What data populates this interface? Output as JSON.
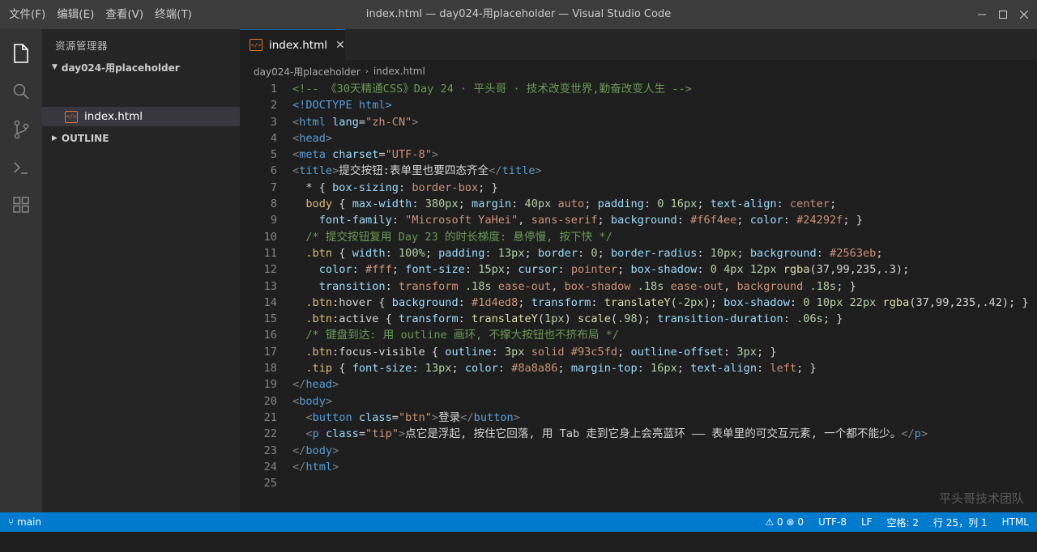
{
  "menu": [
    "文件(F)",
    "编辑(E)",
    "查看(V)",
    "终端(T)"
  ],
  "window": {
    "title": "index.html — day024-用placeholder — Visual Studio Code"
  },
  "activity_bar": [
    "files-icon",
    "search-icon",
    "source-control-icon",
    "terminal-icon",
    "extensions-icon"
  ],
  "sidebar": {
    "title": "资源管理器",
    "folder": "day024-用placeholder",
    "file": "index.html",
    "outline": "OUTLINE"
  },
  "tab": {
    "label": "index.html",
    "icon_text": "</>"
  },
  "breadcrumbs": [
    "day024-用placeholder",
    "index.html"
  ],
  "code_lines": [
    [
      [
        "c",
        "<!-- 《30天精通CSS》Day 24 · 平头哥 · 技术改变世界,勤奋改变人生 -->"
      ]
    ],
    [
      [
        "d",
        "<!DOCTYPE html>"
      ]
    ],
    [
      [
        "p",
        "<"
      ],
      [
        "d",
        "html"
      ],
      [
        "t",
        " "
      ],
      [
        "a",
        "lang"
      ],
      [
        "t",
        "="
      ],
      [
        "s",
        "\"zh-CN\""
      ],
      [
        "p",
        ">"
      ]
    ],
    [
      [
        "p",
        "<"
      ],
      [
        "d",
        "head"
      ],
      [
        "p",
        ">"
      ]
    ],
    [
      [
        "p",
        "<"
      ],
      [
        "d",
        "meta"
      ],
      [
        "t",
        " "
      ],
      [
        "a",
        "charset"
      ],
      [
        "t",
        "="
      ],
      [
        "s",
        "\"UTF-8\""
      ],
      [
        "p",
        ">"
      ]
    ],
    [
      [
        "p",
        "<"
      ],
      [
        "d",
        "title"
      ],
      [
        "p",
        ">"
      ],
      [
        "t",
        "提交按钮:表单里也要四态齐全"
      ],
      [
        "p",
        "</"
      ],
      [
        "d",
        "title"
      ],
      [
        "p",
        ">"
      ]
    ],
    [
      [
        "t",
        "  * { "
      ],
      [
        "a",
        "box-sizing"
      ],
      [
        "t",
        ": "
      ],
      [
        "v",
        "border-box"
      ],
      [
        "t",
        "; }"
      ]
    ],
    [
      [
        "t",
        "  "
      ],
      [
        "y",
        "body"
      ],
      [
        "t",
        " { "
      ],
      [
        "a",
        "max-width"
      ],
      [
        "t",
        ": "
      ],
      [
        "n",
        "380px"
      ],
      [
        "t",
        "; "
      ],
      [
        "a",
        "margin"
      ],
      [
        "t",
        ": "
      ],
      [
        "n",
        "40px"
      ],
      [
        "t",
        " "
      ],
      [
        "v",
        "auto"
      ],
      [
        "t",
        "; "
      ],
      [
        "a",
        "padding"
      ],
      [
        "t",
        ": "
      ],
      [
        "n",
        "0"
      ],
      [
        "t",
        " "
      ],
      [
        "n",
        "16px"
      ],
      [
        "t",
        "; "
      ],
      [
        "a",
        "text-align"
      ],
      [
        "t",
        ": "
      ],
      [
        "v",
        "center"
      ],
      [
        "t",
        ";"
      ]
    ],
    [
      [
        "t",
        "    "
      ],
      [
        "a",
        "font-family"
      ],
      [
        "t",
        ": "
      ],
      [
        "s",
        "\"Microsoft YaHei\""
      ],
      [
        "t",
        ", "
      ],
      [
        "v",
        "sans-serif"
      ],
      [
        "t",
        "; "
      ],
      [
        "a",
        "background"
      ],
      [
        "t",
        ": "
      ],
      [
        "v",
        "#f6f4ee"
      ],
      [
        "t",
        "; "
      ],
      [
        "a",
        "color"
      ],
      [
        "t",
        ": "
      ],
      [
        "v",
        "#24292f"
      ],
      [
        "t",
        "; }"
      ]
    ],
    [
      [
        "t",
        "  "
      ],
      [
        "c",
        "/* 提交按钮复用 Day 23 的时长梯度: 悬停慢, 按下快 */"
      ]
    ],
    [
      [
        "t",
        "  "
      ],
      [
        "y",
        ".btn"
      ],
      [
        "t",
        " { "
      ],
      [
        "a",
        "width"
      ],
      [
        "t",
        ": "
      ],
      [
        "n",
        "100%"
      ],
      [
        "t",
        "; "
      ],
      [
        "a",
        "padding"
      ],
      [
        "t",
        ": "
      ],
      [
        "n",
        "13px"
      ],
      [
        "t",
        "; "
      ],
      [
        "a",
        "border"
      ],
      [
        "t",
        ": "
      ],
      [
        "n",
        "0"
      ],
      [
        "t",
        "; "
      ],
      [
        "a",
        "border-radius"
      ],
      [
        "t",
        ": "
      ],
      [
        "n",
        "10px"
      ],
      [
        "t",
        "; "
      ],
      [
        "a",
        "background"
      ],
      [
        "t",
        ": "
      ],
      [
        "v",
        "#2563eb"
      ],
      [
        "t",
        ";"
      ]
    ],
    [
      [
        "t",
        "    "
      ],
      [
        "a",
        "color"
      ],
      [
        "t",
        ": "
      ],
      [
        "v",
        "#fff"
      ],
      [
        "t",
        "; "
      ],
      [
        "a",
        "font-size"
      ],
      [
        "t",
        ": "
      ],
      [
        "n",
        "15px"
      ],
      [
        "t",
        "; "
      ],
      [
        "a",
        "cursor"
      ],
      [
        "t",
        ": "
      ],
      [
        "v",
        "pointer"
      ],
      [
        "t",
        "; "
      ],
      [
        "a",
        "box-shadow"
      ],
      [
        "t",
        ": "
      ],
      [
        "n",
        "0"
      ],
      [
        "t",
        " "
      ],
      [
        "n",
        "4px"
      ],
      [
        "t",
        " "
      ],
      [
        "n",
        "12px"
      ],
      [
        "t",
        " "
      ],
      [
        "f",
        "rgba"
      ],
      [
        "t",
        "(37,99,235,.3);"
      ]
    ],
    [
      [
        "t",
        "    "
      ],
      [
        "a",
        "transition"
      ],
      [
        "t",
        ": "
      ],
      [
        "v",
        "transform"
      ],
      [
        "t",
        " "
      ],
      [
        "n",
        ".18s"
      ],
      [
        "t",
        " "
      ],
      [
        "v",
        "ease-out"
      ],
      [
        "t",
        ", "
      ],
      [
        "v",
        "box-shadow"
      ],
      [
        "t",
        " "
      ],
      [
        "n",
        ".18s"
      ],
      [
        "t",
        " "
      ],
      [
        "v",
        "ease-out"
      ],
      [
        "t",
        ", "
      ],
      [
        "v",
        "background"
      ],
      [
        "t",
        " "
      ],
      [
        "n",
        ".18s"
      ],
      [
        "t",
        "; }"
      ]
    ],
    [
      [
        "t",
        "  "
      ],
      [
        "y",
        ".btn"
      ],
      [
        "t",
        ":hover { "
      ],
      [
        "a",
        "background"
      ],
      [
        "t",
        ": "
      ],
      [
        "v",
        "#1d4ed8"
      ],
      [
        "t",
        "; "
      ],
      [
        "a",
        "transform"
      ],
      [
        "t",
        ": "
      ],
      [
        "f",
        "translateY"
      ],
      [
        "t",
        "("
      ],
      [
        "n",
        "-2px"
      ],
      [
        "t",
        "); "
      ],
      [
        "a",
        "box-shadow"
      ],
      [
        "t",
        ": "
      ],
      [
        "n",
        "0"
      ],
      [
        "t",
        " "
      ],
      [
        "n",
        "10px"
      ],
      [
        "t",
        " "
      ],
      [
        "n",
        "22px"
      ],
      [
        "t",
        " "
      ],
      [
        "f",
        "rgba"
      ],
      [
        "t",
        "(37,99,235,.42); }"
      ]
    ],
    [
      [
        "t",
        "  "
      ],
      [
        "y",
        ".btn"
      ],
      [
        "t",
        ":active { "
      ],
      [
        "a",
        "transform"
      ],
      [
        "t",
        ": "
      ],
      [
        "f",
        "translateY"
      ],
      [
        "t",
        "("
      ],
      [
        "n",
        "1px"
      ],
      [
        "t",
        ") "
      ],
      [
        "f",
        "scale"
      ],
      [
        "t",
        "("
      ],
      [
        "n",
        ".98"
      ],
      [
        "t",
        "); "
      ],
      [
        "a",
        "transition-duration"
      ],
      [
        "t",
        ": "
      ],
      [
        "n",
        ".06s"
      ],
      [
        "t",
        "; }"
      ]
    ],
    [
      [
        "t",
        "  "
      ],
      [
        "c",
        "/* 键盘到达: 用 outline 画环, 不撑大按钮也不挤布局 */"
      ]
    ],
    [
      [
        "t",
        "  "
      ],
      [
        "y",
        ".btn"
      ],
      [
        "t",
        ":focus-visible { "
      ],
      [
        "a",
        "outline"
      ],
      [
        "t",
        ": "
      ],
      [
        "n",
        "3px"
      ],
      [
        "t",
        " "
      ],
      [
        "v",
        "solid"
      ],
      [
        "t",
        " "
      ],
      [
        "v",
        "#93c5fd"
      ],
      [
        "t",
        "; "
      ],
      [
        "a",
        "outline-offset"
      ],
      [
        "t",
        ": "
      ],
      [
        "n",
        "3px"
      ],
      [
        "t",
        "; }"
      ]
    ],
    [
      [
        "t",
        "  "
      ],
      [
        "y",
        ".tip"
      ],
      [
        "t",
        " { "
      ],
      [
        "a",
        "font-size"
      ],
      [
        "t",
        ": "
      ],
      [
        "n",
        "13px"
      ],
      [
        "t",
        "; "
      ],
      [
        "a",
        "color"
      ],
      [
        "t",
        ": "
      ],
      [
        "v",
        "#8a8a86"
      ],
      [
        "t",
        "; "
      ],
      [
        "a",
        "margin-top"
      ],
      [
        "t",
        ": "
      ],
      [
        "n",
        "16px"
      ],
      [
        "t",
        "; "
      ],
      [
        "a",
        "text-align"
      ],
      [
        "t",
        ": "
      ],
      [
        "v",
        "left"
      ],
      [
        "t",
        "; }"
      ]
    ],
    [
      [
        "p",
        "</"
      ],
      [
        "d",
        "head"
      ],
      [
        "p",
        ">"
      ]
    ],
    [
      [
        "p",
        "<"
      ],
      [
        "d",
        "body"
      ],
      [
        "p",
        ">"
      ]
    ],
    [
      [
        "t",
        "  "
      ],
      [
        "p",
        "<"
      ],
      [
        "d",
        "button"
      ],
      [
        "t",
        " "
      ],
      [
        "a",
        "class"
      ],
      [
        "t",
        "="
      ],
      [
        "s",
        "\"btn\""
      ],
      [
        "p",
        ">"
      ],
      [
        "t",
        "登录"
      ],
      [
        "p",
        "</"
      ],
      [
        "d",
        "button"
      ],
      [
        "p",
        ">"
      ]
    ],
    [
      [
        "t",
        "  "
      ],
      [
        "p",
        "<"
      ],
      [
        "d",
        "p"
      ],
      [
        "t",
        " "
      ],
      [
        "a",
        "class"
      ],
      [
        "t",
        "="
      ],
      [
        "s",
        "\"tip\""
      ],
      [
        "p",
        ">"
      ],
      [
        "t",
        "点它是浮起, 按住它回落, 用 Tab 走到它身上会亮蓝环 —— 表单里的可交互元素, 一个都不能少。"
      ],
      [
        "p",
        "</"
      ],
      [
        "d",
        "p"
      ],
      [
        "p",
        ">"
      ]
    ],
    [
      [
        "p",
        "</"
      ],
      [
        "d",
        "body"
      ],
      [
        "p",
        ">"
      ]
    ],
    [
      [
        "p",
        "</"
      ],
      [
        "d",
        "html"
      ],
      [
        "p",
        ">"
      ]
    ],
    [
      [
        "t",
        ""
      ]
    ]
  ],
  "watermark": "平头哥技术团队",
  "status": {
    "branch": "main",
    "problems_warn": "0",
    "problems_err": "0",
    "encoding": "UTF-8",
    "eol": "LF",
    "indent": "空格: 2",
    "position": "行 25，列 1",
    "language": "HTML"
  },
  "colors": {
    "accent": "#007acc",
    "html_icon": "#e37933"
  }
}
